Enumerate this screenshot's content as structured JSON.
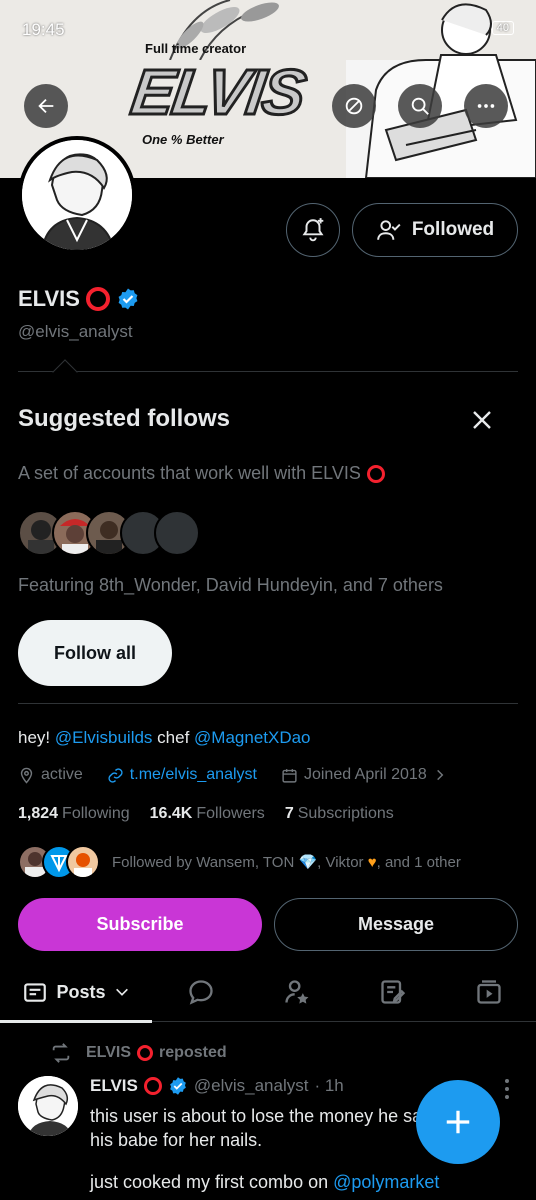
{
  "status": {
    "time": "19:45",
    "battery": "40"
  },
  "banner": {
    "subtitle": "Full time creator",
    "title": "ELVIS",
    "tagline": "One % Better"
  },
  "profile": {
    "display_name": "ELVIS",
    "verified": true,
    "handle": "@elvis_analyst",
    "followed_label": "Followed"
  },
  "suggested": {
    "title": "Suggested follows",
    "description": "A set of accounts that work well with ELVIS",
    "featuring": "Featuring 8th_Wonder, David Hundeyin, and 7 others",
    "follow_all_label": "Follow all"
  },
  "bio": {
    "prefix": "hey! ",
    "mention1": "@Elvisbuilds",
    "middle": " chef ",
    "mention2": "@MagnetXDao"
  },
  "meta": {
    "location": "active",
    "website": "t.me/elvis_analyst",
    "joined": "Joined April 2018"
  },
  "stats": {
    "following_count": "1,824",
    "following_label": "Following",
    "followers_count": "16.4K",
    "followers_label": "Followers",
    "subscriptions_count": "7",
    "subscriptions_label": "Subscriptions"
  },
  "followed_by": {
    "prefix": "Followed by Wansem, TON ",
    "middle": ", Viktor ",
    "suffix": ", and 1 other"
  },
  "actions": {
    "subscribe_label": "Subscribe",
    "message_label": "Message"
  },
  "tabs": {
    "posts_label": "Posts"
  },
  "post": {
    "repost_label": "ELVIS",
    "repost_suffix": "reposted",
    "author_name": "ELVIS",
    "author_handle": "@elvis_analyst",
    "time": "· 1h",
    "text_line1": "this user is about to lose the money he saved",
    "text_line2": "his babe for her nails.",
    "text_line3_prefix": "just cooked my first combo on ",
    "text_line3_mention": "@polymarket"
  },
  "colors": {
    "accent": "#1d9bf0",
    "subscribe": "#c936d6",
    "badge_red": "#f4212e"
  }
}
